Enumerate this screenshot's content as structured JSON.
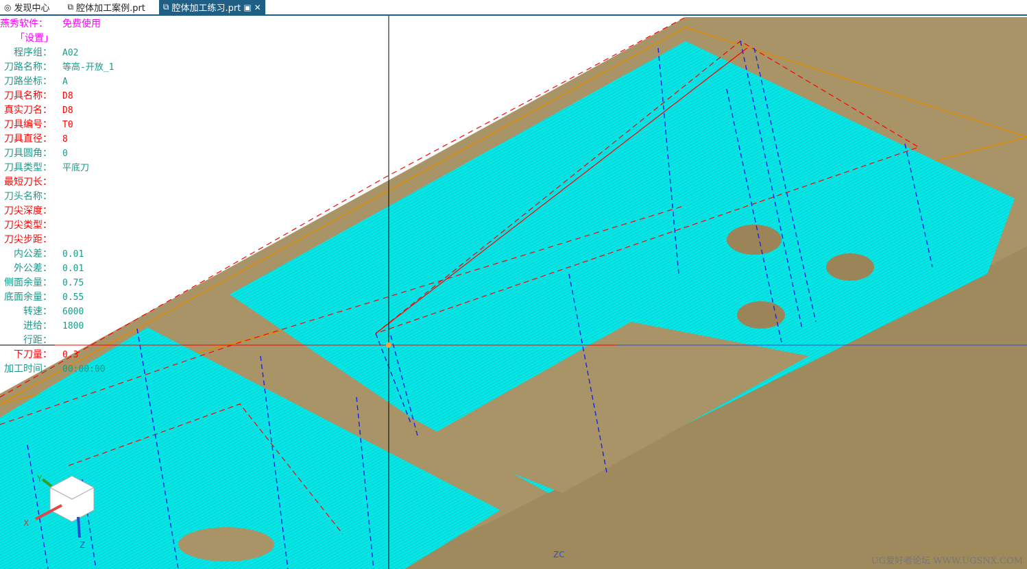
{
  "tabs": [
    {
      "label": "发现中心",
      "icon": "discovery-icon"
    },
    {
      "label": "腔体加工案例.prt",
      "icon": "part-file-icon"
    },
    {
      "label": "腔体加工练习.prt",
      "icon": "part-file-icon",
      "active": true
    }
  ],
  "info_panel": {
    "header": {
      "label": "燕秀软件：",
      "value": "免费使用"
    },
    "section": "「设置」",
    "rows": [
      {
        "label": "程序组：",
        "value": "A02",
        "color": "teal"
      },
      {
        "label": "刀路名称：",
        "value": "等高-开放_1",
        "color": "teal"
      },
      {
        "label": "刀路坐标：",
        "value": "A",
        "color": "teal"
      },
      {
        "label": "刀具名称：",
        "value": "D8",
        "color": "red"
      },
      {
        "label": "真实刀名：",
        "value": "D8",
        "color": "red"
      },
      {
        "label": "刀具编号：",
        "value": "T0",
        "color": "red"
      },
      {
        "label": "刀具直径：",
        "value": "8",
        "color": "red"
      },
      {
        "label": "刀具圆角：",
        "value": "0",
        "color": "teal"
      },
      {
        "label": "刀具类型：",
        "value": "平底刀",
        "color": "teal"
      },
      {
        "label": "最短刀长：",
        "value": "",
        "color": "red"
      },
      {
        "label": "刀头名称：",
        "value": "",
        "color": "teal"
      },
      {
        "label": "刀尖深度：",
        "value": "",
        "color": "red"
      },
      {
        "label": "刀尖类型：",
        "value": "",
        "color": "red"
      },
      {
        "label": "刀尖步距：",
        "value": "",
        "color": "red"
      },
      {
        "label": "内公差：",
        "value": "0.01",
        "color": "teal"
      },
      {
        "label": "外公差：",
        "value": "0.01",
        "color": "teal"
      },
      {
        "label": "侧面余量：",
        "value": "0.75",
        "color": "teal"
      },
      {
        "label": "底面余量：",
        "value": "0.55",
        "color": "teal"
      },
      {
        "label": "转速：",
        "value": "6000",
        "color": "teal"
      },
      {
        "label": "进给：",
        "value": "1800",
        "color": "teal"
      },
      {
        "label": "行距：",
        "value": "",
        "color": "teal"
      },
      {
        "label": "下刀量：",
        "value": "0.3",
        "color": "red"
      },
      {
        "label": "加工时间：",
        "value": "00:00:00",
        "color": "teal"
      }
    ]
  },
  "viewport": {
    "axis_x": "X",
    "axis_y": "Y",
    "axis_z": "Z",
    "zc_label": "ZC"
  },
  "watermark": "UG爱好者论坛 WWW.UGSNX.COM",
  "colors": {
    "tab_active": "#1f5f86",
    "part": "#a89466",
    "toolpath": "#00e8e8"
  }
}
